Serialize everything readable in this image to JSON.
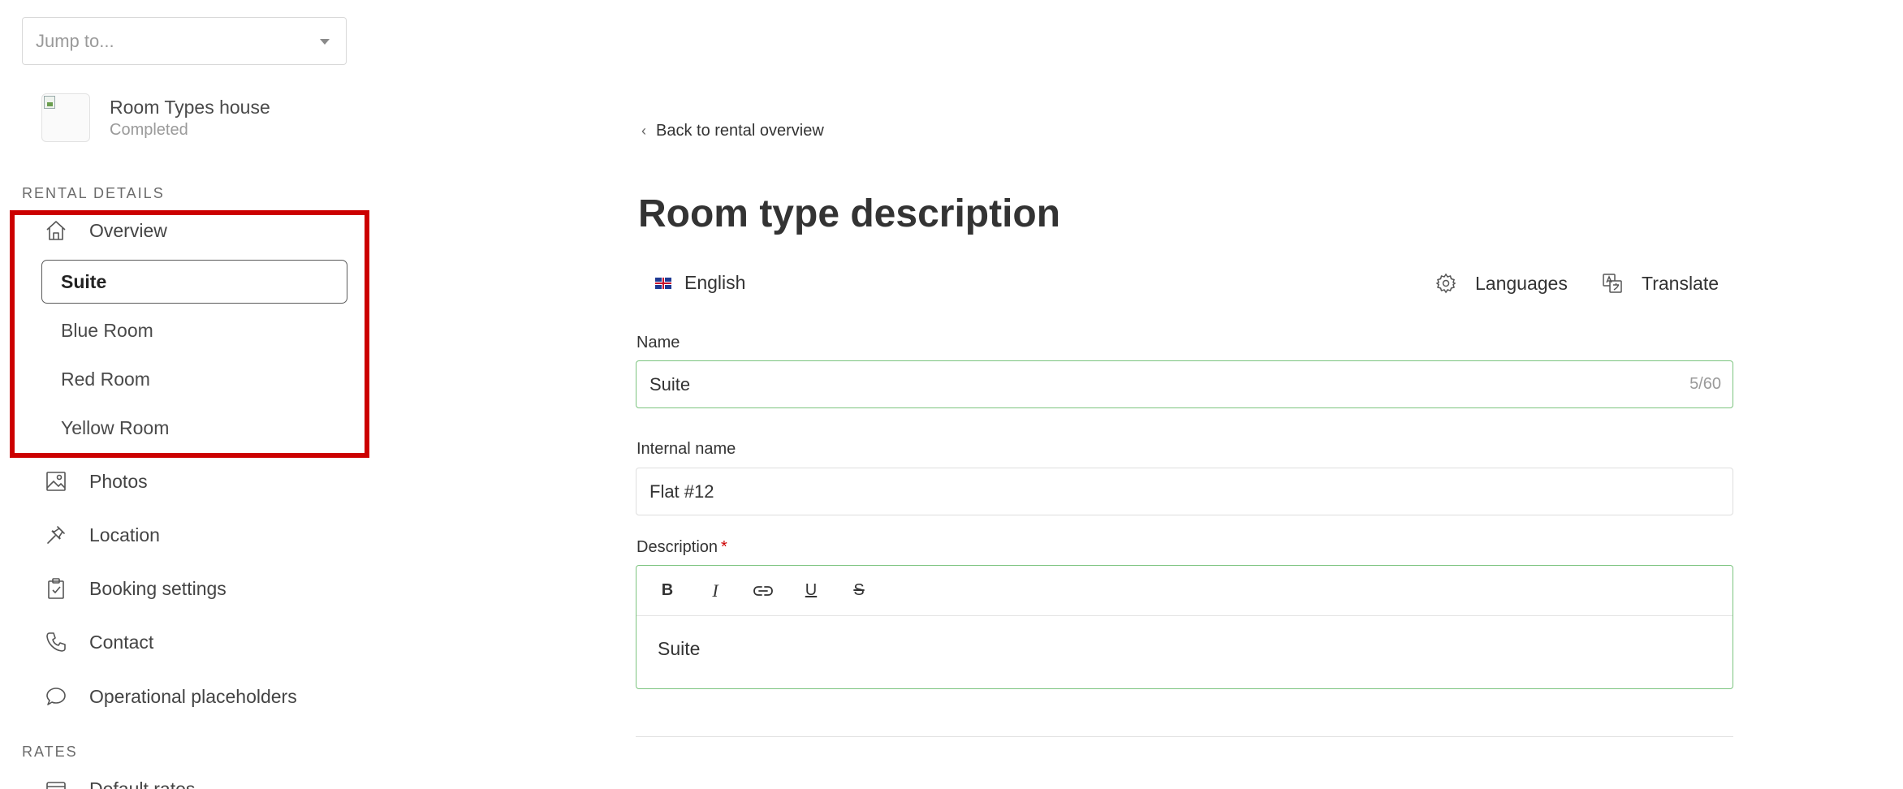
{
  "sidebar": {
    "jump_placeholder": "Jump to...",
    "property": {
      "name": "Room Types house",
      "status": "Completed"
    },
    "rental_details_heading": "RENTAL DETAILS",
    "overview_label": "Overview",
    "room_types": [
      {
        "label": "Suite",
        "active": true
      },
      {
        "label": "Blue Room",
        "active": false
      },
      {
        "label": "Red Room",
        "active": false
      },
      {
        "label": "Yellow Room",
        "active": false
      }
    ],
    "items": [
      {
        "label": "Photos",
        "icon": "image-icon"
      },
      {
        "label": "Location",
        "icon": "pin-icon"
      },
      {
        "label": "Booking settings",
        "icon": "clipboard-check-icon"
      },
      {
        "label": "Contact",
        "icon": "phone-icon"
      },
      {
        "label": "Operational placeholders",
        "icon": "chat-bubble-icon"
      }
    ],
    "rates_heading": "RATES",
    "rates_items": [
      {
        "label": "Default rates",
        "icon": "rates-icon"
      }
    ]
  },
  "main": {
    "back_link": "Back to rental overview",
    "title": "Room type description",
    "language_tab": "English",
    "languages_button": "Languages",
    "translate_button": "Translate",
    "name_field": {
      "label": "Name",
      "value": "Suite",
      "counter": "5/60"
    },
    "internal_name_field": {
      "label": "Internal name",
      "value": "Flat #12"
    },
    "description_field": {
      "label": "Description",
      "required_mark": "*",
      "toolbar": [
        "B",
        "I",
        "link",
        "U",
        "S"
      ],
      "content": "Suite"
    }
  },
  "colors": {
    "highlight": "#cc0000",
    "valid_border": "#7cc47f",
    "text": "#333333"
  }
}
